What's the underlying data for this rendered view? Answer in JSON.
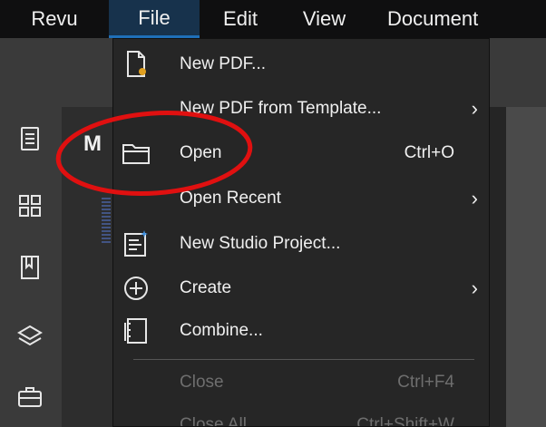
{
  "menubar": {
    "items": [
      {
        "label": "Revu"
      },
      {
        "label": "File"
      },
      {
        "label": "Edit"
      },
      {
        "label": "View"
      },
      {
        "label": "Document"
      }
    ]
  },
  "panel": {
    "title": "M"
  },
  "file_menu": {
    "items": [
      {
        "label": "New PDF...",
        "icon": "new-pdf-icon"
      },
      {
        "label": "New PDF from Template...",
        "submenu": "›"
      },
      {
        "label": "Open",
        "shortcut": "Ctrl+O",
        "icon": "folder-icon"
      },
      {
        "label": "Open Recent",
        "submenu": "›"
      },
      {
        "label": "New Studio Project...",
        "icon": "studio-project-icon"
      },
      {
        "label": "Create",
        "icon": "plus-circle-icon",
        "submenu": "›"
      },
      {
        "label": "Combine...",
        "icon": "combine-icon"
      },
      {
        "label": "Close",
        "shortcut": "Ctrl+F4",
        "disabled": true
      },
      {
        "label": "Close All",
        "shortcut": "Ctrl+Shift+W",
        "disabled": true
      }
    ]
  },
  "annotation": {
    "color": "#e01010",
    "target": "Open"
  },
  "colors": {
    "menubar_bg": "#0f0f10",
    "file_active_bg": "#17324c",
    "menu_bg": "#262626"
  }
}
